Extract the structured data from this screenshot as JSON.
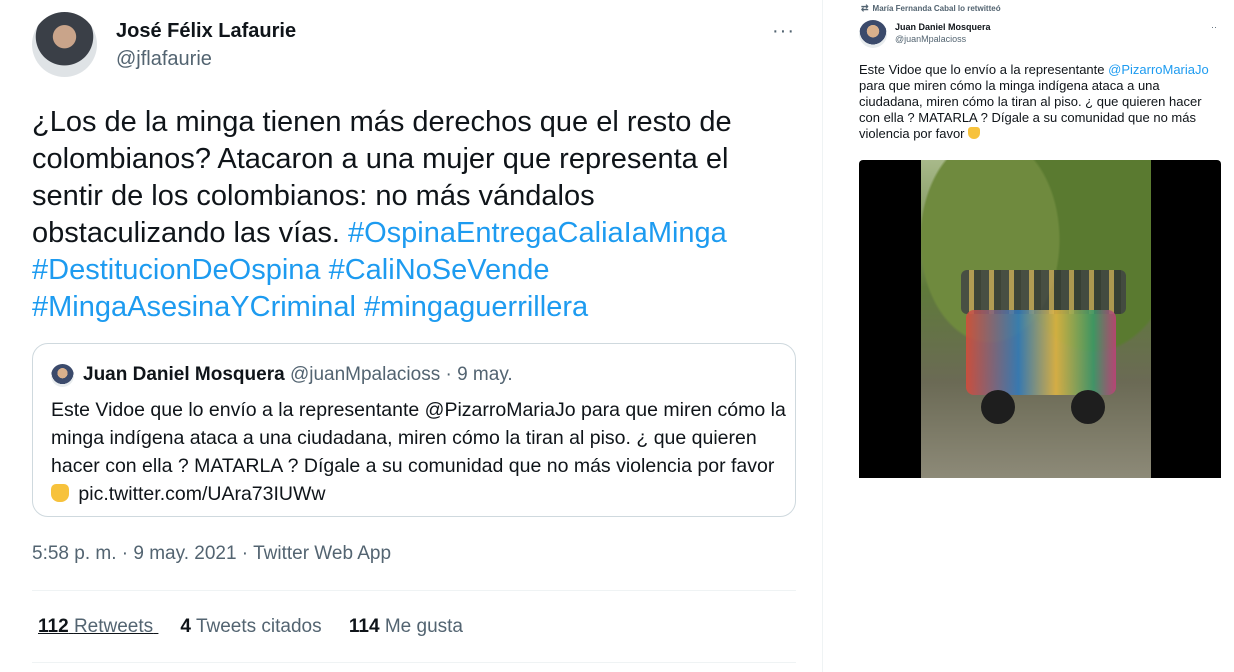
{
  "main_tweet": {
    "author_name": "José Félix Lafaurie",
    "author_handle": "@jflafaurie",
    "more_label": "···",
    "text_plain": "¿Los de la minga tienen más derechos que el resto de colombianos? Atacaron a una mujer que representa el sentir de los colombianos: no más vándalos obstaculizando las vías.",
    "hashtags": [
      "#OspinaEntregaCaliaIaMinga",
      "#DestitucionDeOspina",
      "#CaliNoSeVende",
      "#MingaAsesinaYCriminal",
      "#mingaguerrillera"
    ],
    "timestamp": "5:58 p. m. · 9 may. 2021 · Twitter Web App"
  },
  "quoted_tweet": {
    "author_name": "Juan Daniel Mosquera",
    "author_handle": "@juanMpalacioss",
    "date": "· 9 may.",
    "text": "Este Vidoe que lo envío a la representante @PizarroMariaJo para que miren cómo la minga indígena ataca a una ciudadana, miren cómo la tiran al piso. ¿ que quieren hacer con ella ? MATARLA ? Dígale a su comunidad que no más violencia por favor",
    "link": "pic.twitter.com/UAra73IUWw"
  },
  "stats": {
    "retweets_count": "112",
    "retweets_label": "Retweets",
    "quotes_count": "4",
    "quotes_label": "Tweets citados",
    "likes_count": "114",
    "likes_label": "Me gusta"
  },
  "embedded_screenshot": {
    "retweet_line": "María Fernanda Cabal lo retwitteó",
    "author_name": "Juan Daniel Mosquera",
    "author_handle": "@juanMpalacioss",
    "more_label": "··",
    "text_before": "Este Vidoe que lo envío a la representante",
    "mention": "@PizarroMariaJo",
    "text_after": "para que miren cómo la minga indígena ataca a una ciudadana, miren cómo la tiran al piso. ¿ que quieren hacer con ella ? MATARLA ? Dígale a su comunidad que no más violencia por favor"
  },
  "colors": {
    "link": "#1d9bf0",
    "muted": "#536471",
    "text": "#0f1419"
  }
}
